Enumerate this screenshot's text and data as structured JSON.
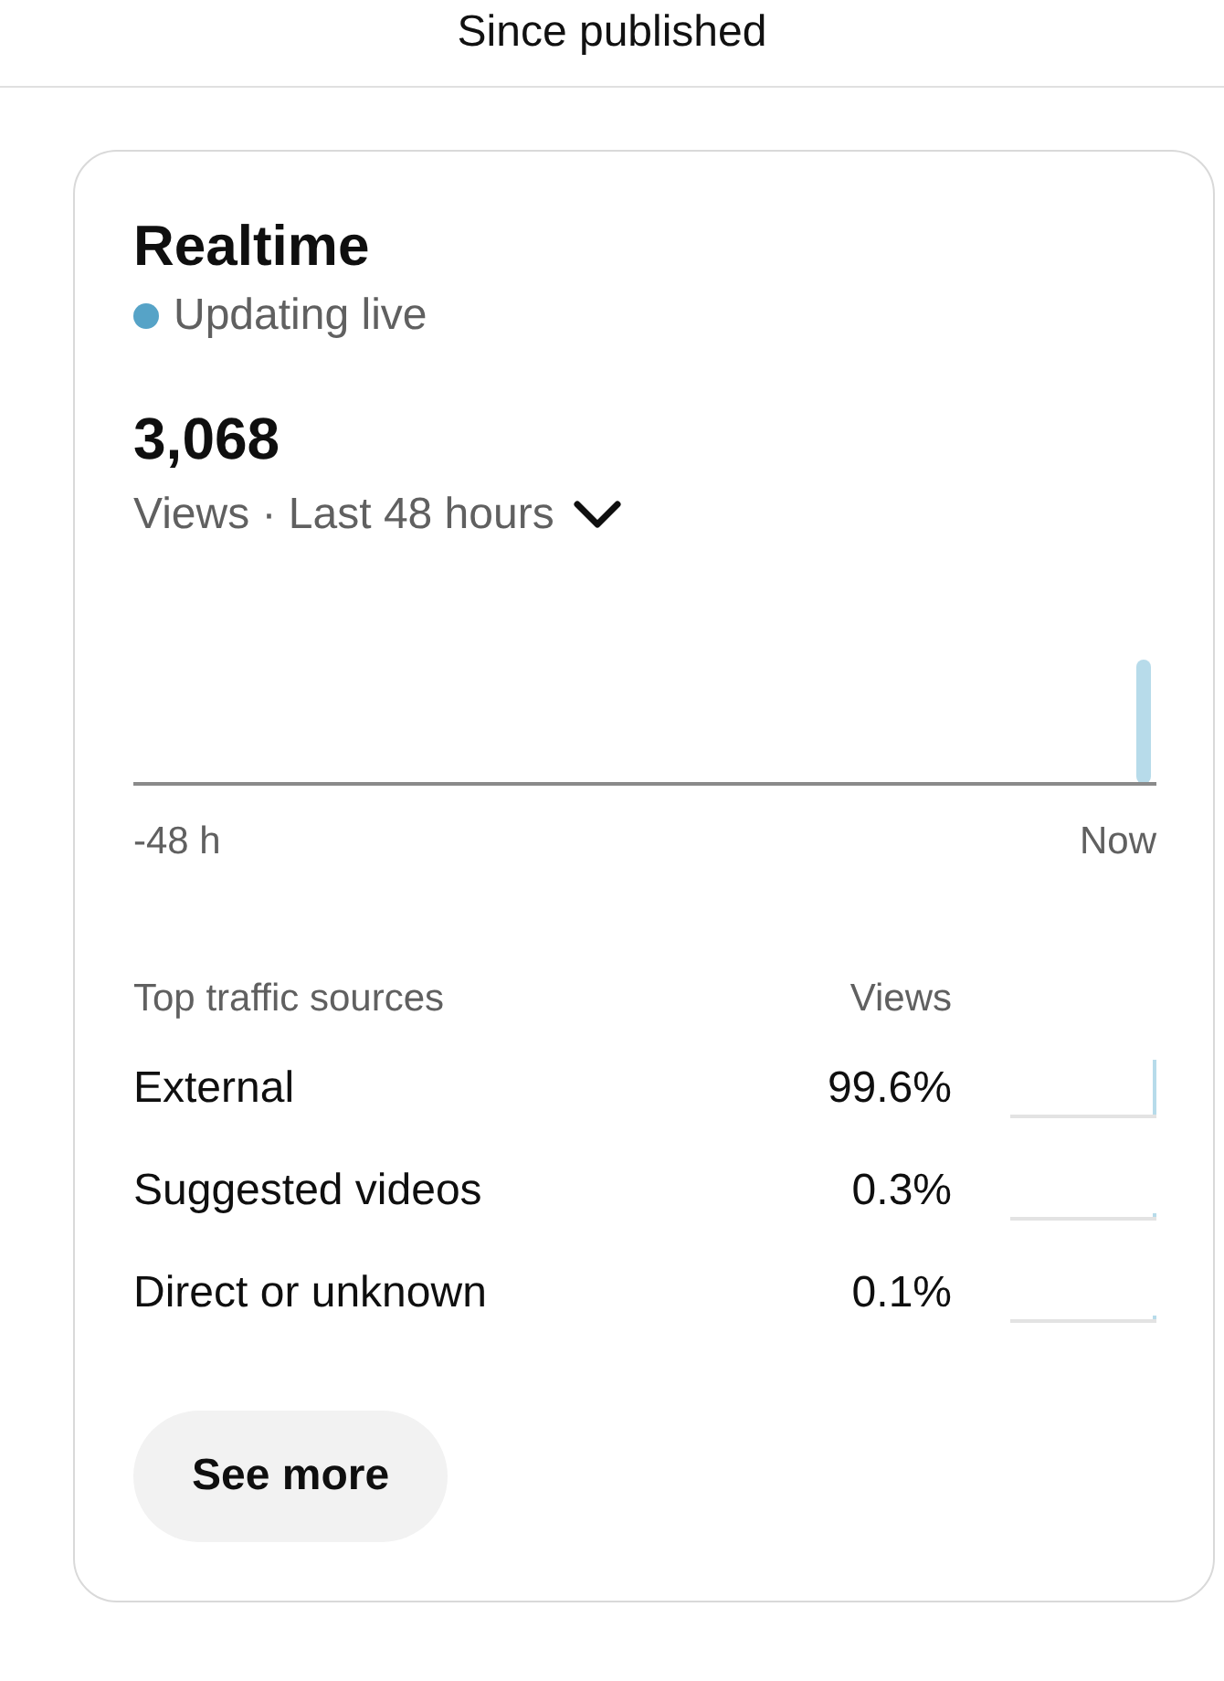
{
  "header": {
    "title": "Since published"
  },
  "card": {
    "title": "Realtime",
    "status": {
      "label": "Updating live",
      "color": "#56a3c7"
    },
    "total": "3,068",
    "metric_selector": "Views · Last 48 hours",
    "chart_axis": {
      "start": "-48 h",
      "end": "Now"
    },
    "traffic": {
      "column_1": "Top traffic sources",
      "column_2": "Views",
      "rows": [
        {
          "name": "External",
          "value": "99.6%",
          "level": 0.996
        },
        {
          "name": "Suggested videos",
          "value": "0.3%",
          "level": 0.003
        },
        {
          "name": "Direct or unknown",
          "value": "0.1%",
          "level": 0.001
        }
      ]
    },
    "button": "See more"
  }
}
